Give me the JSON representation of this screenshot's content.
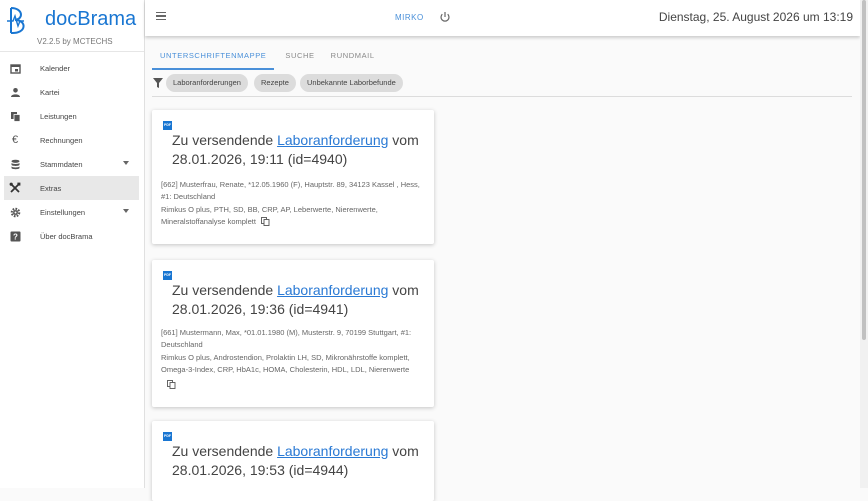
{
  "brand": {
    "name": "docBrama",
    "version": "V2.2.5 by MCTECHS"
  },
  "sidebar": {
    "items": [
      {
        "label": "Kalender",
        "icon": "calendar-icon"
      },
      {
        "label": "Kartei",
        "icon": "person-icon"
      },
      {
        "label": "Leistungen",
        "icon": "copy-stack-icon"
      },
      {
        "label": "Rechnungen",
        "icon": "euro-icon"
      },
      {
        "label": "Stammdaten",
        "icon": "database-icon",
        "expandable": true
      },
      {
        "label": "Extras",
        "icon": "tools-icon",
        "active": true
      },
      {
        "label": "Einstellungen",
        "icon": "gear-icon",
        "expandable": true
      },
      {
        "label": "Über docBrama",
        "icon": "help-icon"
      }
    ]
  },
  "header": {
    "user": "MIRKO",
    "datetime": "Dienstag, 25. August 2026 um 13:19"
  },
  "tabs": [
    {
      "label": "UNTERSCHRIFTENMAPPE",
      "active": true
    },
    {
      "label": "SUCHE",
      "active": false
    },
    {
      "label": "RUNDMAIL",
      "active": false
    }
  ],
  "filters": [
    "Laboranforderungen",
    "Rezepte",
    "Unbekannte Laborbefunde"
  ],
  "cards": [
    {
      "title_prefix": "Zu versendende ",
      "title_link": "Laboranforderung",
      "title_suffix": " vom 28.01.2026, 19:11 (id=4940)",
      "patient": "[662] Musterfrau, Renate, *12.05.1960 (F), Hauptstr. 89, 34123 Kassel , Hess, #1: Deutschland",
      "tests": "Rimkus O plus, PTH, SD, BB, CRP, AP, Leberwerte, Nierenwerte, Mineralstoffanalyse komplett"
    },
    {
      "title_prefix": "Zu versendende ",
      "title_link": "Laboranforderung",
      "title_suffix": " vom 28.01.2026, 19:36 (id=4941)",
      "patient": "[661] Mustermann, Max, *01.01.1980 (M), Musterstr. 9, 70199 Stuttgart, #1: Deutschland",
      "tests": "Rimkus O plus, Androstendion, Prolaktin LH, SD, Mikronährstoffe komplett, Omega-3-Index, CRP, HbA1c, HOMA, Cholesterin, HDL, LDL, Nierenwerte"
    },
    {
      "title_prefix": "Zu versendende ",
      "title_link": "Laboranforderung",
      "title_suffix": " vom 28.01.2026, 19:53 (id=4944)",
      "patient": "",
      "tests": ""
    }
  ],
  "colors": {
    "accent": "#1976d2",
    "link": "#2979d4",
    "tab_active": "#4a90d9"
  }
}
